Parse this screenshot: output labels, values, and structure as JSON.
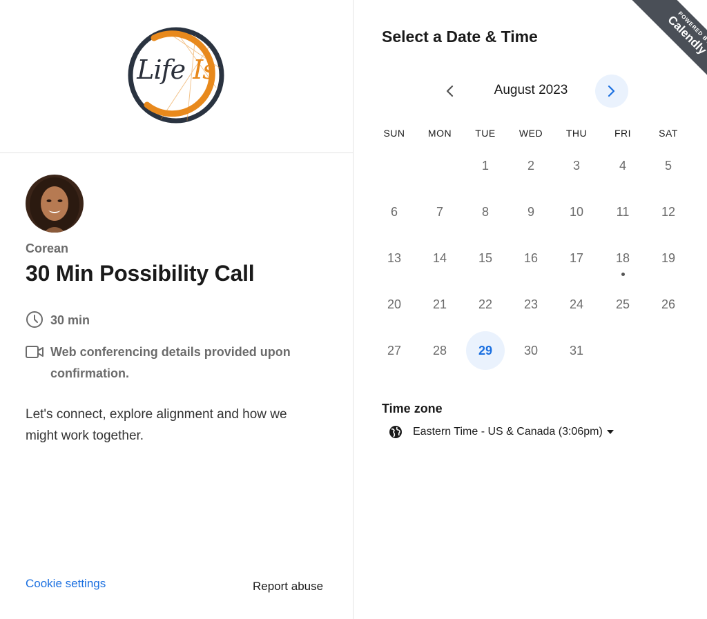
{
  "brand": {
    "logo_text_1": "Life",
    "logo_text_2": "Is",
    "logo_colors": {
      "ring_dark": "#2a3340",
      "ring_orange": "#e8891c"
    }
  },
  "event": {
    "host": "Corean",
    "title": "30 Min Possibility Call",
    "duration": "30 min",
    "conferencing": "Web conferencing details provided upon confirmation.",
    "description": "Let's connect, explore alignment and how we might work together."
  },
  "footer": {
    "cookie_settings": "Cookie settings",
    "report_abuse": "Report abuse"
  },
  "scheduler": {
    "heading": "Select a Date & Time",
    "month_label": "August 2023",
    "weekdays": [
      "SUN",
      "MON",
      "TUE",
      "WED",
      "THU",
      "FRI",
      "SAT"
    ],
    "weeks": [
      [
        "",
        "",
        "1",
        "2",
        "3",
        "4",
        "5"
      ],
      [
        "6",
        "7",
        "8",
        "9",
        "10",
        "11",
        "12"
      ],
      [
        "13",
        "14",
        "15",
        "16",
        "17",
        "18",
        "19"
      ],
      [
        "20",
        "21",
        "22",
        "23",
        "24",
        "25",
        "26"
      ],
      [
        "27",
        "28",
        "29",
        "30",
        "31",
        "",
        ""
      ]
    ],
    "selected_day": "29",
    "today": "18",
    "timezone_label": "Time zone",
    "timezone_value": "Eastern Time - US & Canada (3:06pm)"
  },
  "ribbon": {
    "small": "POWERED BY",
    "big": "Calendly"
  },
  "colors": {
    "accent": "#1a6fe0",
    "accent_bg": "#eaf2fd",
    "muted_text": "#6b6b6b"
  }
}
